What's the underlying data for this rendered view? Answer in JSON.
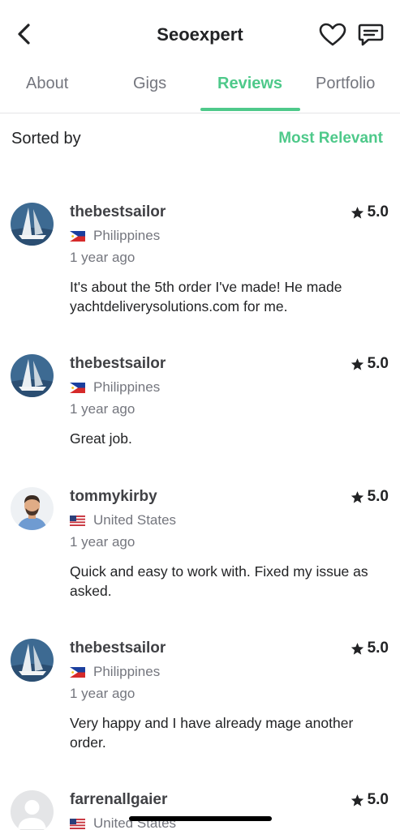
{
  "header": {
    "title": "Seoexpert",
    "back_icon": "chevron-left-icon",
    "favorite_icon": "heart-icon",
    "message_icon": "chat-icon"
  },
  "tabs": [
    {
      "label": "About"
    },
    {
      "label": "Gigs"
    },
    {
      "label": "Reviews"
    },
    {
      "label": "Portfolio"
    }
  ],
  "sort": {
    "label": "Sorted by",
    "value": "Most Relevant"
  },
  "colors": {
    "accent": "#4ec98a",
    "text_primary": "#222325",
    "text_secondary": "#74767e"
  },
  "reviews": [
    {
      "username": "thebestsailor",
      "rating": "5.0",
      "country": "Philippines",
      "flag": "flag-philippines-icon",
      "time": "1 year ago",
      "text": "It's about the 5th order I've made! He made yachtdeliverysolutions.com for me."
    },
    {
      "username": "thebestsailor",
      "rating": "5.0",
      "country": "Philippines",
      "flag": "flag-philippines-icon",
      "time": "1 year ago",
      "text": "Great job."
    },
    {
      "username": "tommykirby",
      "rating": "5.0",
      "country": "United States",
      "flag": "flag-united-states-icon",
      "time": "1 year ago",
      "text": "Quick and easy to work with. Fixed my issue as asked."
    },
    {
      "username": "thebestsailor",
      "rating": "5.0",
      "country": "Philippines",
      "flag": "flag-philippines-icon",
      "time": "1 year ago",
      "text": "Very happy and I have already mage another order."
    },
    {
      "username": "farrenallgaier",
      "rating": "5.0",
      "country": "United States",
      "flag": "flag-united-states-icon",
      "time": "",
      "text": ""
    }
  ]
}
